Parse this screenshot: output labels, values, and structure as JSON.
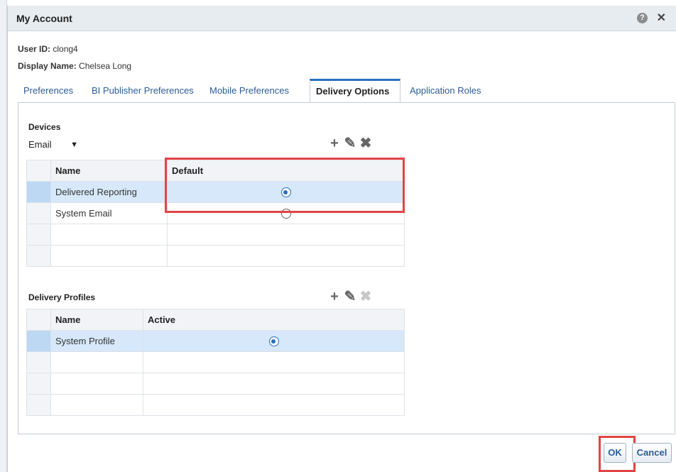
{
  "dialog": {
    "title": "My Account",
    "user_id_label": "User ID:",
    "user_id_value": "clong4",
    "display_name_label": "Display Name:",
    "display_name_value": "Chelsea Long"
  },
  "tabs": [
    {
      "label": "Preferences"
    },
    {
      "label": "BI Publisher Preferences"
    },
    {
      "label": "Mobile Preferences"
    },
    {
      "label": "Delivery Options"
    },
    {
      "label": "Application Roles"
    }
  ],
  "active_tab": "Delivery Options",
  "devices": {
    "section_label": "Devices",
    "selected_device": "Email",
    "columns": [
      "Name",
      "Default"
    ],
    "rows": [
      {
        "name": "Delivered Reporting",
        "default": true
      },
      {
        "name": "System Email",
        "default": false
      }
    ]
  },
  "profiles": {
    "section_label": "Delivery Profiles",
    "columns": [
      "Name",
      "Active"
    ],
    "rows": [
      {
        "name": "System Profile",
        "active": true
      }
    ]
  },
  "buttons": {
    "ok": "OK",
    "cancel": "Cancel"
  },
  "icons": {
    "help": "?",
    "close": "✕",
    "add": "+",
    "edit": "✎",
    "delete": "✖"
  },
  "colors": {
    "accent": "#2a6fbf",
    "highlight": "#e24444",
    "selected_row": "#d6e8fa"
  }
}
